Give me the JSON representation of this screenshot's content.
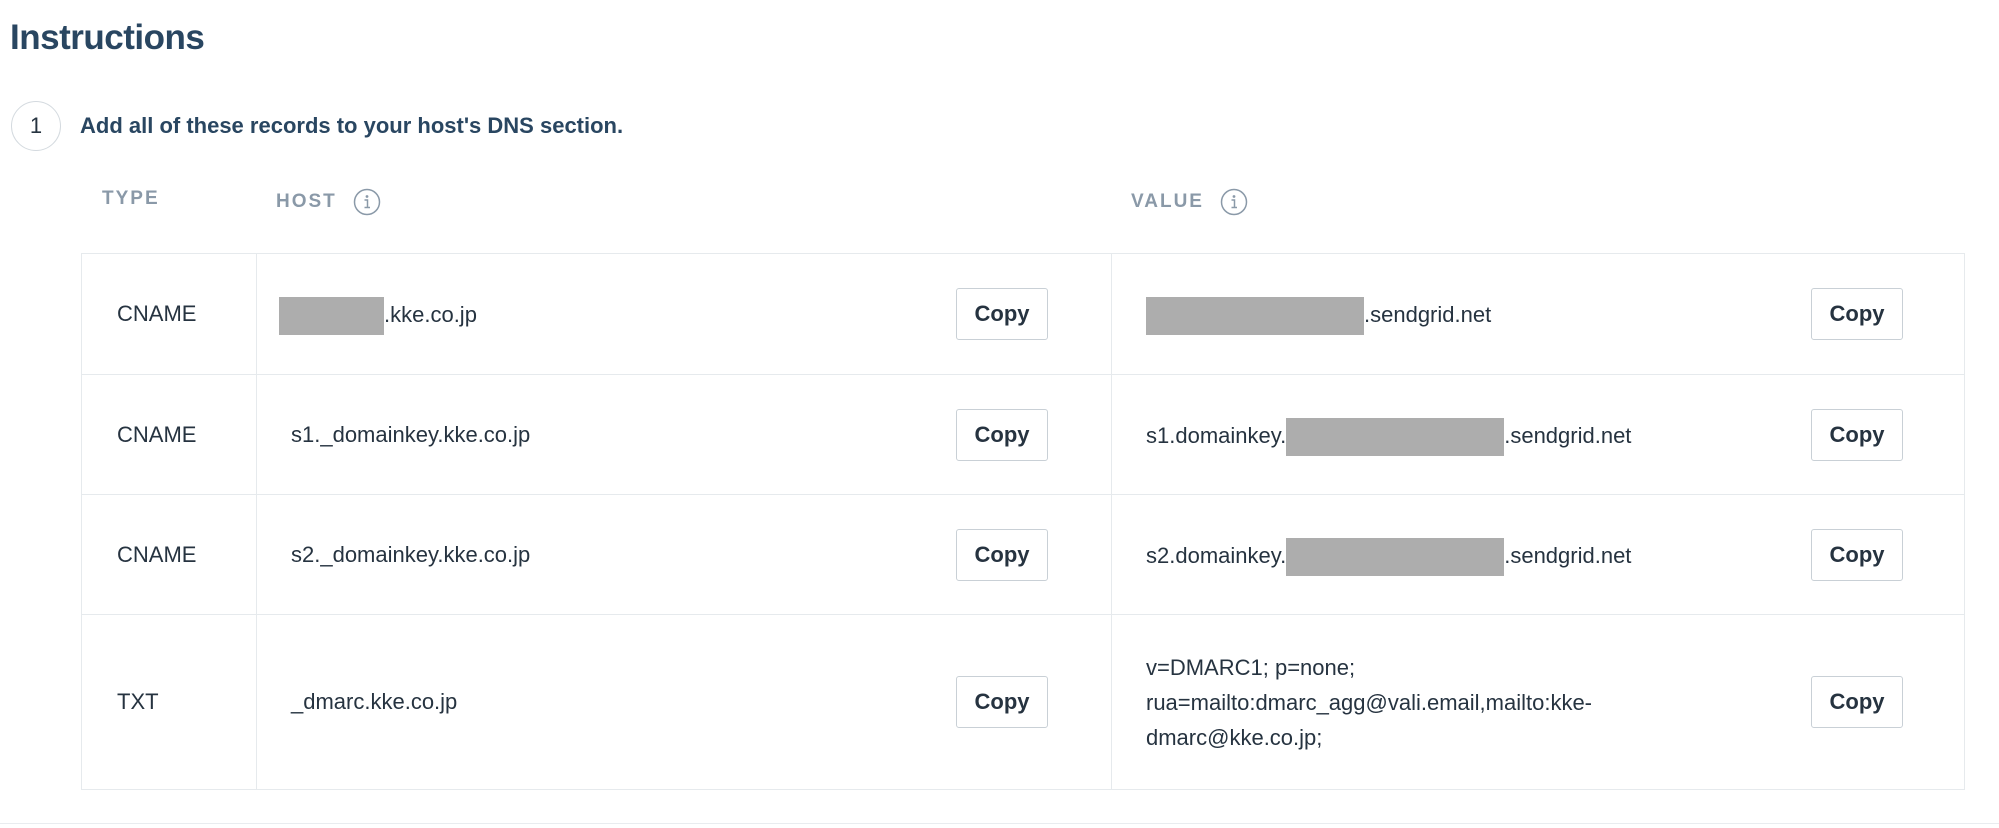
{
  "page": {
    "title": "Instructions"
  },
  "step": {
    "number": "1",
    "text": "Add all of these records to your host's DNS section."
  },
  "table": {
    "headers": {
      "type": "TYPE",
      "host": "HOST",
      "value": "VALUE"
    },
    "copy_label": "Copy",
    "rows": [
      {
        "type": "CNAME",
        "host_suffix": ".kke.co.jp",
        "value_prefix": "",
        "value_suffix": ".sendgrid.net"
      },
      {
        "type": "CNAME",
        "host": "s1._domainkey.kke.co.jp",
        "value_prefix": "s1.domainkey.",
        "value_suffix": ".sendgrid.net"
      },
      {
        "type": "CNAME",
        "host": "s2._domainkey.kke.co.jp",
        "value_prefix": "s2.domainkey.",
        "value_suffix": ".sendgrid.net"
      },
      {
        "type": "TXT",
        "host": "_dmarc.kke.co.jp",
        "value_lines": [
          "v=DMARC1; p=none;",
          "rua=mailto:dmarc_agg@vali.email,mailto:kke-",
          "dmarc@kke.co.jp;"
        ]
      }
    ]
  },
  "colors": {
    "title": "#294661",
    "header_text": "#8a99a8",
    "border": "#e6eaed",
    "redaction": "#adadad"
  },
  "icons": {
    "header_info": "info-icon"
  }
}
